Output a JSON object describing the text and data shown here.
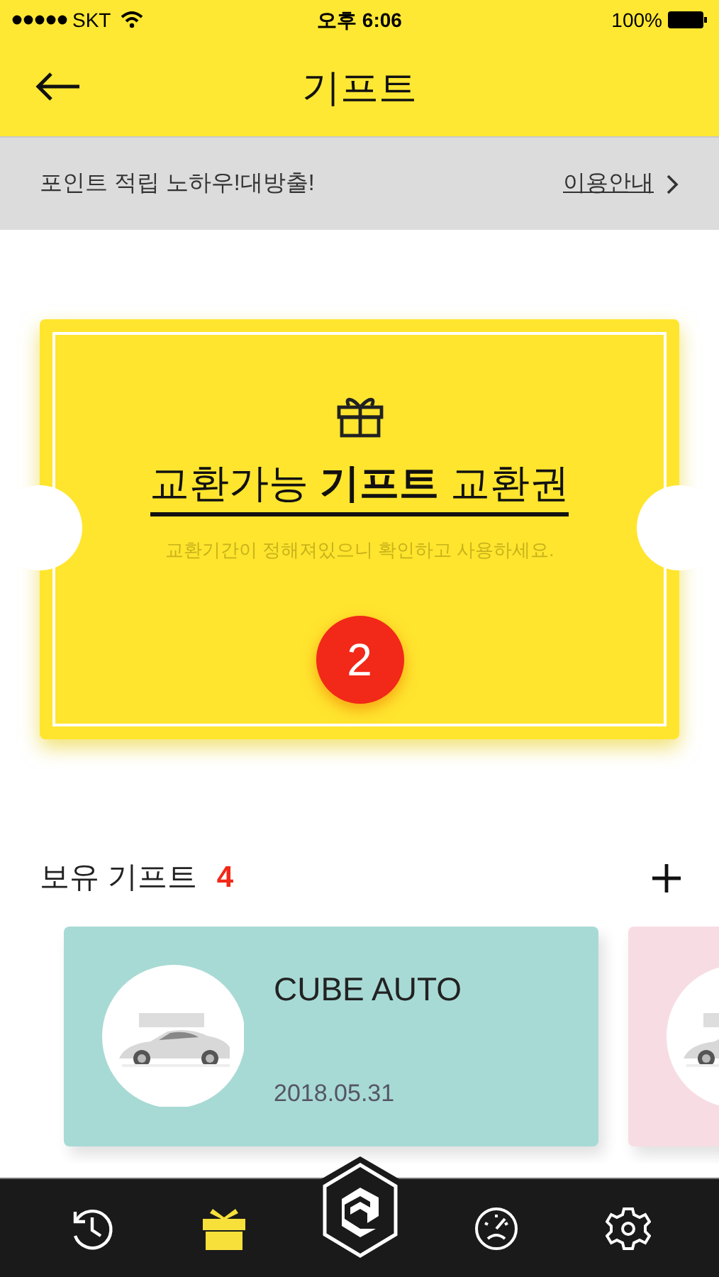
{
  "status_bar": {
    "carrier": "SKT",
    "time": "오후 6:06",
    "battery": "100%"
  },
  "header": {
    "title": "기프트"
  },
  "banner": {
    "text": "포인트 적립 노하우!대방출!",
    "link": "이용안내"
  },
  "ticket": {
    "title": "교환가능 **기프트** 교환권",
    "subtitle": "교환기간이 정해져있으니 확인하고 사용하세요.",
    "count": "2"
  },
  "section": {
    "title": "보유 기프트",
    "count": "4"
  },
  "gifts": [
    {
      "title": "CUBE AUTO",
      "date": "2018.05.31",
      "color": "#a8dad5",
      "kind": "picture"
    },
    {
      "color": "#f7dde3",
      "kind": "picture"
    }
  ],
  "tabs": [
    {
      "kind": "history",
      "selected": false
    },
    {
      "kind": "gift",
      "selected": true
    },
    {
      "kind": "logo",
      "selected": false
    },
    {
      "kind": "gauge",
      "selected": false
    },
    {
      "kind": "settings",
      "selected": false
    }
  ]
}
